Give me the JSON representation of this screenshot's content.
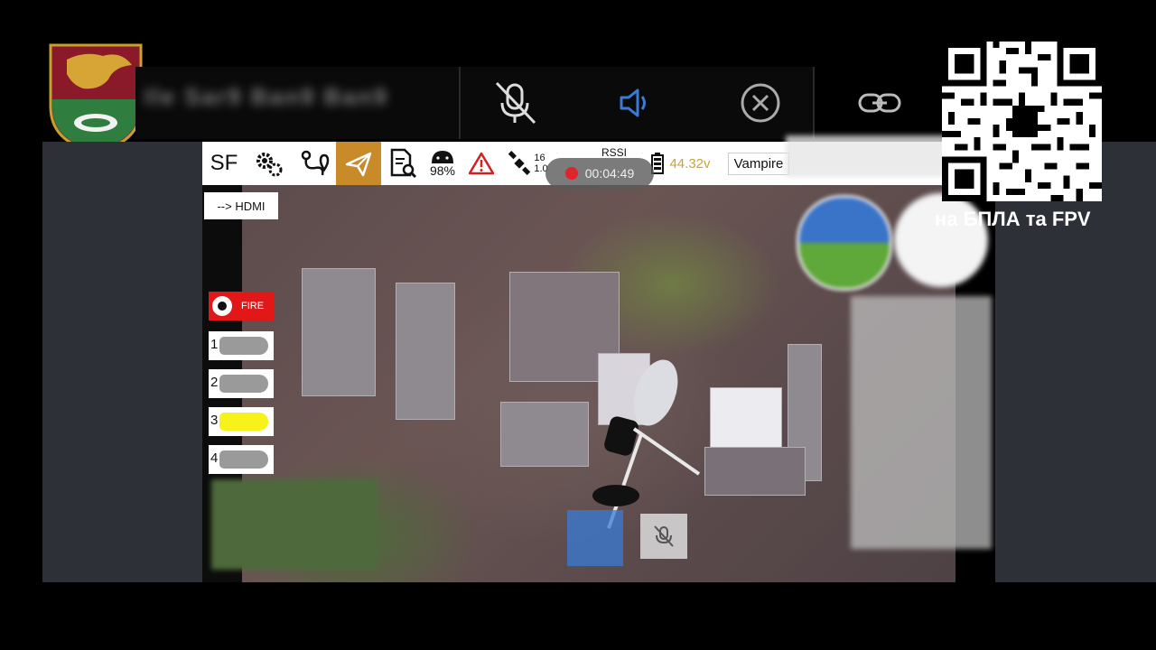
{
  "caller": {
    "name": "Ile Sar9 Ban9 Ban9"
  },
  "call_controls": [
    {
      "name": "mute-mic",
      "icon": "mic-off-icon"
    },
    {
      "name": "speaker",
      "icon": "speaker-icon"
    },
    {
      "name": "end-call",
      "icon": "close-circle-icon"
    },
    {
      "name": "share-link",
      "icon": "link-icon"
    }
  ],
  "toolbar": {
    "brand": "SF",
    "battery_pct": "98%",
    "satellites": "16",
    "satellites_sub": "1.0",
    "rssi_label": "RSSI",
    "voltage": "44.32v",
    "profile": "Vampire",
    "recording_time": "00:04:49"
  },
  "hdmi_button": "--> HDMI",
  "fire_button": "FIRE",
  "bomb_slots": [
    {
      "label": "1",
      "state": "loaded",
      "color": "#9a9a9a"
    },
    {
      "label": "2",
      "state": "loaded",
      "color": "#9a9a9a"
    },
    {
      "label": "3",
      "state": "selected",
      "color": "#f6f21a"
    },
    {
      "label": "4",
      "state": "loaded",
      "color": "#9a9a9a"
    }
  ],
  "promo_text": "на БПЛА та FPV",
  "colors": {
    "accent_orange": "#c98a2a",
    "voltage": "#c8a23c",
    "fire": "#e21818",
    "speaker": "#3a7bd5",
    "emblem_red": "#8a1a2a",
    "emblem_green": "#2f7d3f"
  }
}
